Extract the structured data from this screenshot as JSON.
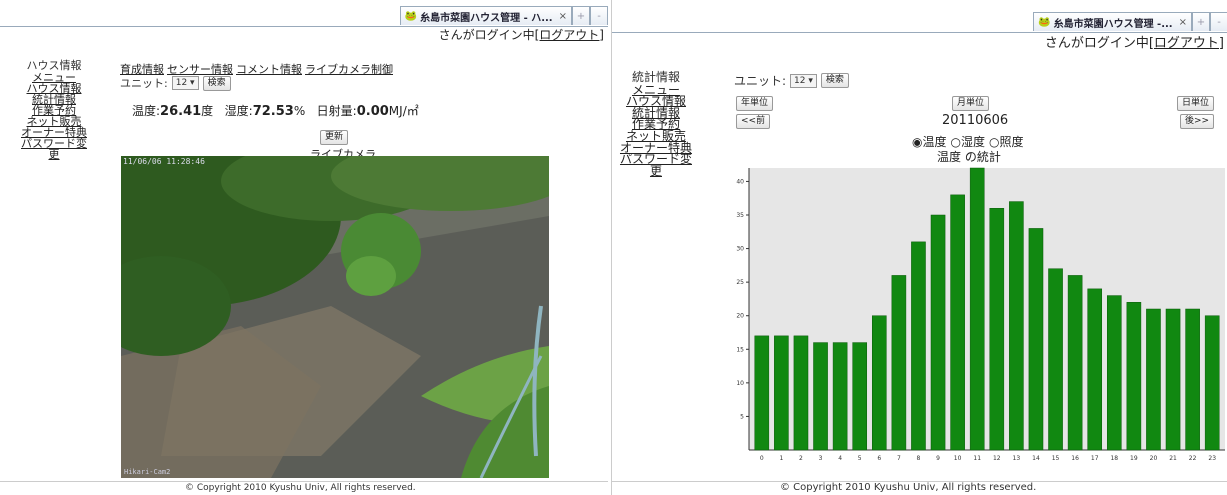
{
  "left": {
    "tab_title": "糸島市菜園ハウス管理 - ハ...",
    "tab_close": "×",
    "tab_new": "+",
    "login_text": "さんがログイン中",
    "logout_link": "[ログアウト]",
    "nav": {
      "heading": "ハウス情報",
      "items": [
        "メニュー",
        "ハウス情報",
        "統計情報",
        "作業予約",
        "ネット販売",
        "オーナー特典",
        "パスワード変更"
      ]
    },
    "top_links": [
      "育成情報",
      "センサー情報",
      "コメント情報",
      "ライブカメラ制御"
    ],
    "unit_label": "ユニット:",
    "unit_value": "12 ▾",
    "search_button": "検索",
    "readings": {
      "temp_label": "温度:",
      "temp_value": "26.41",
      "temp_unit": "度",
      "hum_label": "湿度:",
      "hum_value": "72.53",
      "hum_unit": "%",
      "sun_label": "日射量:",
      "sun_value": "0.00",
      "sun_unit": "MJ/㎡"
    },
    "refresh_button": "更新",
    "camera_label": "ライブカメラ",
    "camera_timestamp": "11/06/06 11:28:46",
    "camera_watermark": "Hikari-Cam2",
    "copyright": "© Copyright 2010 Kyushu Univ, All rights reserved."
  },
  "right": {
    "tab_title": "糸島市菜園ハウス管理 -...",
    "tab_close": "×",
    "tab_new": "+",
    "login_text": "さんがログイン中",
    "logout_link": "[ログアウト]",
    "nav": {
      "heading": "統計情報",
      "items": [
        "メニュー",
        "ハウス情報",
        "統計情報",
        "作業予約",
        "ネット販売",
        "オーナー特典",
        "パスワード変更"
      ]
    },
    "unit_label": "ユニット:",
    "unit_value": "12 ▾",
    "search_button": "検索",
    "year_button": "年単位",
    "month_button": "月単位",
    "day_button": "日単位",
    "prev_button": "<<前",
    "next_button": "後>>",
    "date": "20110606",
    "radio_options": [
      "温度",
      "湿度",
      "照度"
    ],
    "radio_selected": "温度",
    "chart_title": "温度 の統計",
    "copyright": "© Copyright 2010 Kyushu Univ, All rights reserved."
  },
  "chart_data": {
    "type": "bar",
    "title": "温度 の統計",
    "categories": [
      "0",
      "1",
      "2",
      "3",
      "4",
      "5",
      "6",
      "7",
      "8",
      "9",
      "10",
      "11",
      "12",
      "13",
      "14",
      "15",
      "16",
      "17",
      "18",
      "19",
      "20",
      "21",
      "22",
      "23"
    ],
    "values": [
      17,
      17,
      17,
      16,
      16,
      16,
      20,
      26,
      31,
      35,
      38,
      42,
      36,
      37,
      33,
      27,
      26,
      24,
      23,
      22,
      21,
      21,
      21,
      20
    ],
    "yticks": [
      5,
      10,
      15,
      20,
      25,
      30,
      35,
      40
    ],
    "ylim": [
      0,
      42
    ],
    "bar_color": "#118811",
    "plot_bg": "#e6e6e6",
    "grid": false
  }
}
